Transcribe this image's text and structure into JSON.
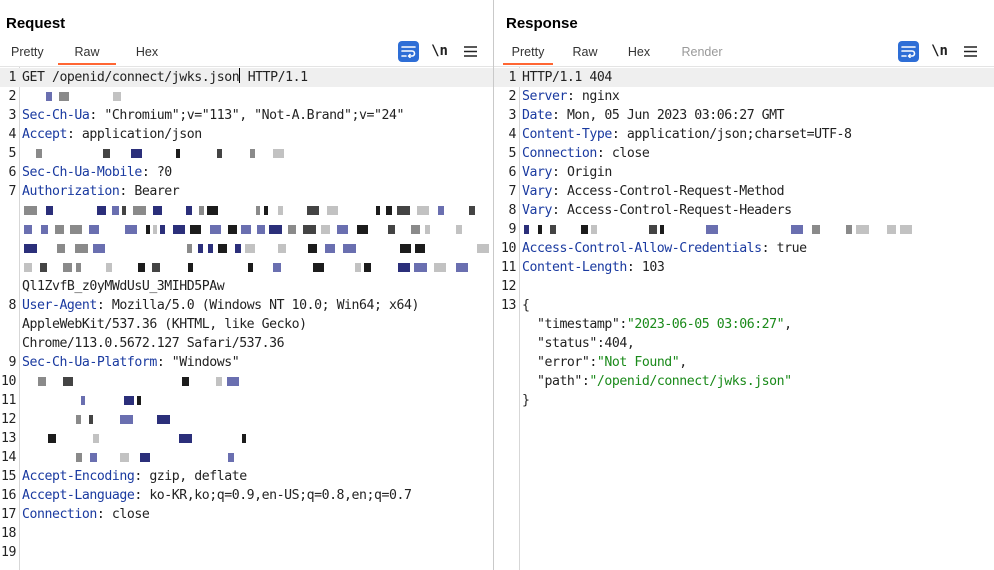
{
  "request": {
    "title": "Request",
    "tabs": [
      {
        "label": "Pretty",
        "active": false
      },
      {
        "label": "Raw",
        "active": true
      },
      {
        "label": "Hex",
        "active": false
      }
    ],
    "newline_label": "\\n",
    "lines": [
      {
        "n": "1",
        "parts": [
          {
            "t": "GET /openid/connect/jwks.json",
            "c": "plain"
          },
          {
            "caret": true
          },
          {
            "t": " HTTP/1.1",
            "c": "plain"
          }
        ],
        "hl": true
      },
      {
        "n": "2",
        "parts": [],
        "redacted": true
      },
      {
        "n": "3",
        "parts": [
          {
            "t": "Sec-Ch-Ua",
            "c": "hname"
          },
          {
            "t": ": \"Chromium\";v=\"113\", \"Not-A.Brand\";v=\"24\"",
            "c": "hval"
          }
        ]
      },
      {
        "n": "4",
        "parts": [
          {
            "t": "Accept",
            "c": "hname"
          },
          {
            "t": ": application/json",
            "c": "hval"
          }
        ]
      },
      {
        "n": "5",
        "parts": [],
        "redacted": true
      },
      {
        "n": "6",
        "parts": [
          {
            "t": "Sec-Ch-Ua-Mobile",
            "c": "hname"
          },
          {
            "t": ": ?0",
            "c": "hval"
          }
        ]
      },
      {
        "n": "7",
        "parts": [
          {
            "t": "Authorization",
            "c": "hname"
          },
          {
            "t": ": Bearer",
            "c": "hval"
          }
        ]
      },
      {
        "n": "",
        "parts": [],
        "redacted": true
      },
      {
        "n": "",
        "parts": [],
        "redacted": true
      },
      {
        "n": "",
        "parts": [],
        "redacted": true
      },
      {
        "n": "",
        "parts": [],
        "redacted": true
      },
      {
        "n": "",
        "parts": [
          {
            "t": "Ql1ZvfB_z0yMWdUsU_3MIHD5PAw",
            "c": "plain"
          }
        ]
      },
      {
        "n": "8",
        "parts": [
          {
            "t": "User-Agent",
            "c": "hname"
          },
          {
            "t": ": Mozilla/5.0 (Windows NT 10.0; Win64; x64)",
            "c": "hval"
          }
        ]
      },
      {
        "n": "",
        "parts": [
          {
            "t": "AppleWebKit/537.36 (KHTML, like Gecko)",
            "c": "plain"
          }
        ]
      },
      {
        "n": "",
        "parts": [
          {
            "t": "Chrome/113.0.5672.127 Safari/537.36",
            "c": "plain"
          }
        ]
      },
      {
        "n": "9",
        "parts": [
          {
            "t": "Sec-Ch-Ua-Platform",
            "c": "hname"
          },
          {
            "t": ": \"Windows\"",
            "c": "hval"
          }
        ]
      },
      {
        "n": "10",
        "parts": [],
        "redacted": true
      },
      {
        "n": "11",
        "parts": [],
        "redacted": true
      },
      {
        "n": "12",
        "parts": [],
        "redacted": true
      },
      {
        "n": "13",
        "parts": [],
        "redacted": true
      },
      {
        "n": "14",
        "parts": [],
        "redacted": true
      },
      {
        "n": "15",
        "parts": [
          {
            "t": "Accept-Encoding",
            "c": "hname"
          },
          {
            "t": ": gzip, deflate",
            "c": "hval"
          }
        ]
      },
      {
        "n": "16",
        "parts": [
          {
            "t": "Accept-Language",
            "c": "hname"
          },
          {
            "t": ": ko-KR,ko;q=0.9,en-US;q=0.8,en;q=0.7",
            "c": "hval"
          }
        ]
      },
      {
        "n": "17",
        "parts": [
          {
            "t": "Connection",
            "c": "hname"
          },
          {
            "t": ": close",
            "c": "hval"
          }
        ]
      },
      {
        "n": "18",
        "parts": []
      },
      {
        "n": "19",
        "parts": []
      }
    ]
  },
  "response": {
    "title": "Response",
    "tabs": [
      {
        "label": "Pretty",
        "active": true
      },
      {
        "label": "Raw",
        "active": false
      },
      {
        "label": "Hex",
        "active": false
      },
      {
        "label": "Render",
        "active": false,
        "disabled": true
      }
    ],
    "newline_label": "\\n",
    "lines": [
      {
        "n": "1",
        "parts": [
          {
            "t": "HTTP/1.1 404",
            "c": "plain"
          }
        ],
        "hl": true
      },
      {
        "n": "2",
        "parts": [
          {
            "t": "Server",
            "c": "hname"
          },
          {
            "t": ": nginx",
            "c": "hval"
          }
        ]
      },
      {
        "n": "3",
        "parts": [
          {
            "t": "Date",
            "c": "hname"
          },
          {
            "t": ": Mon, 05 Jun 2023 03:06:27 GMT",
            "c": "hval"
          }
        ]
      },
      {
        "n": "4",
        "parts": [
          {
            "t": "Content-Type",
            "c": "hname"
          },
          {
            "t": ": application/json;charset=UTF-8",
            "c": "hval"
          }
        ]
      },
      {
        "n": "5",
        "parts": [
          {
            "t": "Connection",
            "c": "hname"
          },
          {
            "t": ": close",
            "c": "hval"
          }
        ]
      },
      {
        "n": "6",
        "parts": [
          {
            "t": "Vary",
            "c": "hname"
          },
          {
            "t": ": Origin",
            "c": "hval"
          }
        ]
      },
      {
        "n": "7",
        "parts": [
          {
            "t": "Vary",
            "c": "hname"
          },
          {
            "t": ": Access-Control-Request-Method",
            "c": "hval"
          }
        ]
      },
      {
        "n": "8",
        "parts": [
          {
            "t": "Vary",
            "c": "hname"
          },
          {
            "t": ": Access-Control-Request-Headers",
            "c": "hval"
          }
        ]
      },
      {
        "n": "9",
        "parts": [],
        "redacted": true
      },
      {
        "n": "10",
        "parts": [
          {
            "t": "Access-Control-Allow-Credentials",
            "c": "hname"
          },
          {
            "t": ": true",
            "c": "hval"
          }
        ]
      },
      {
        "n": "11",
        "parts": [
          {
            "t": "Content-Length",
            "c": "hname"
          },
          {
            "t": ": 103",
            "c": "hval"
          }
        ]
      },
      {
        "n": "12",
        "parts": []
      },
      {
        "n": "13",
        "parts": [
          {
            "t": "{",
            "c": "plain"
          }
        ]
      },
      {
        "n": "",
        "parts": [
          {
            "t": "  \"timestamp\"",
            "c": "jkey"
          },
          {
            "t": ":",
            "c": "plain"
          },
          {
            "t": "\"2023-06-05 03:06:27\"",
            "c": "jstr"
          },
          {
            "t": ",",
            "c": "plain"
          }
        ]
      },
      {
        "n": "",
        "parts": [
          {
            "t": "  \"status\"",
            "c": "jkey"
          },
          {
            "t": ":",
            "c": "plain"
          },
          {
            "t": "404",
            "c": "jnum"
          },
          {
            "t": ",",
            "c": "plain"
          }
        ]
      },
      {
        "n": "",
        "parts": [
          {
            "t": "  \"error\"",
            "c": "jkey"
          },
          {
            "t": ":",
            "c": "plain"
          },
          {
            "t": "\"Not Found\"",
            "c": "jstr"
          },
          {
            "t": ",",
            "c": "plain"
          }
        ]
      },
      {
        "n": "",
        "parts": [
          {
            "t": "  \"path\"",
            "c": "jkey"
          },
          {
            "t": ":",
            "c": "plain"
          },
          {
            "t": "\"/openid/connect/jwks.json\"",
            "c": "jstr"
          }
        ]
      },
      {
        "n": "",
        "parts": [
          {
            "t": "}",
            "c": "plain"
          }
        ]
      }
    ]
  },
  "colors": {
    "accent_blue": "#2e6ed6",
    "tab_underline": "#ff6633",
    "header_name": "#1a3aa0",
    "json_string": "#1a8a1a"
  },
  "icons": {
    "wrap": "word-wrap-icon",
    "menu": "hamburger-menu-icon",
    "layout_split": "split-layout-icon",
    "layout_h": "horizontal-layout-icon",
    "layout_v": "vertical-layout-icon"
  }
}
